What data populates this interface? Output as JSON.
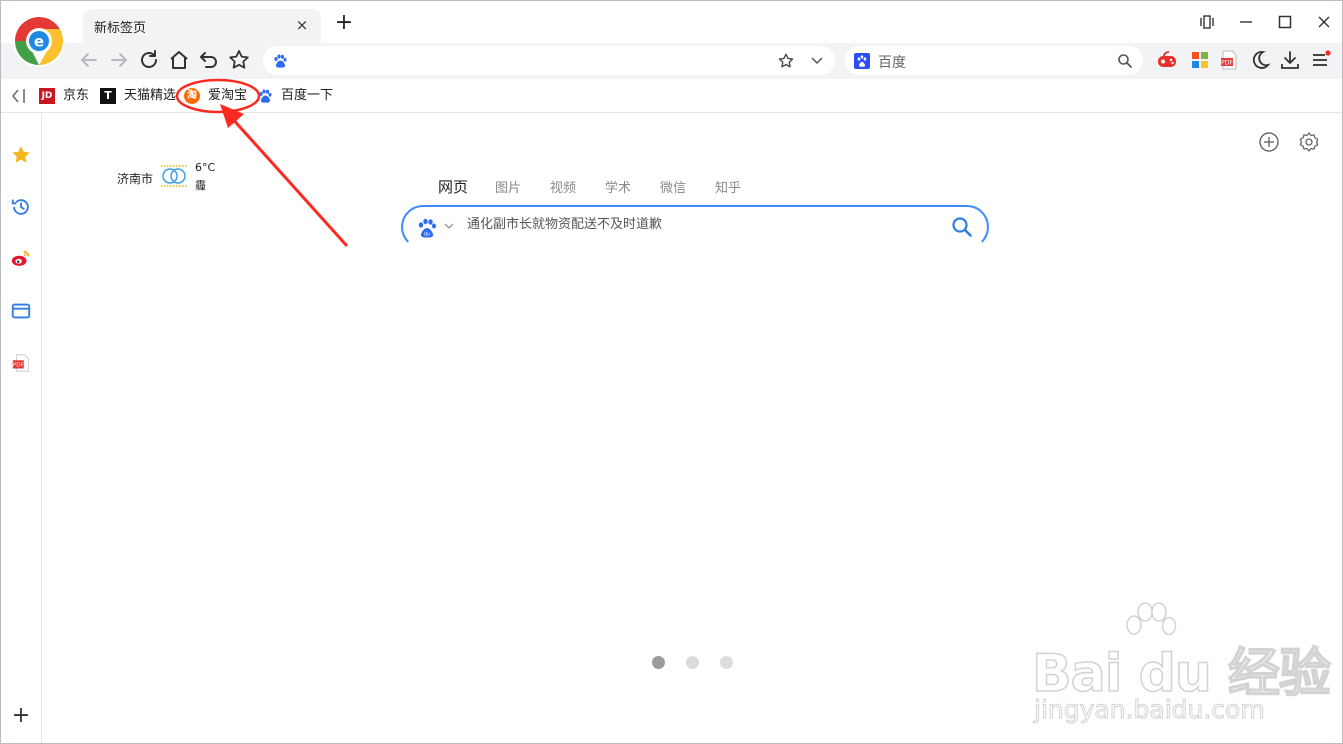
{
  "browser": {
    "tab_title": "新标签页",
    "tab_close": "×",
    "new_tab": "+",
    "window_controls": {
      "restore": "⧉",
      "minimize": "—",
      "maximize": "☐",
      "close": "✕"
    }
  },
  "toolbar": {
    "address_value": "",
    "search_engine": "百度"
  },
  "bookmarks": [
    {
      "label": "京东",
      "icon": "JD",
      "color": "#c81623"
    },
    {
      "label": "天猫精选",
      "icon": "T",
      "color": "#e2001a"
    },
    {
      "label": "爱淘宝",
      "icon": "淘",
      "color": "#ff5000"
    },
    {
      "label": "百度一下",
      "icon": "baidu-paw-icon",
      "color": "#2c6cf5"
    }
  ],
  "sidebar": {
    "items": [
      "favorites-star-icon",
      "history-icon",
      "weibo-icon",
      "browser-window-icon",
      "pdf-icon"
    ],
    "add": "+"
  },
  "weather": {
    "city": "济南市",
    "temperature": "6°C",
    "condition": "霾"
  },
  "search_tabs": [
    "网页",
    "图片",
    "视频",
    "学术",
    "微信",
    "知乎"
  ],
  "search": {
    "placeholder": "通化副市长就物资配送不及时道歉"
  },
  "carousel_dots": {
    "count": 3,
    "active": 0
  },
  "watermark": {
    "brand": "Bai du 经验",
    "url": "jingyan.baidu.com"
  },
  "colors": {
    "accent_blue": "#3d8bff",
    "annotation_red": "#ff2a1f",
    "toolbar_bg": "#f2f3f5"
  }
}
